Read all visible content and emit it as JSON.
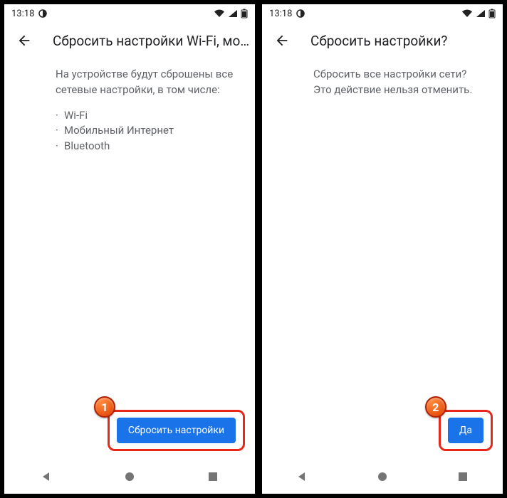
{
  "status": {
    "time": "13:18"
  },
  "screens": [
    {
      "title": "Сбросить настройки Wi-Fi, мо…",
      "body": "На устройстве будут сброшены все сетевые настройки, в том числе:",
      "items": [
        "Wi-Fi",
        "Мобильный Интернет",
        "Bluetooth"
      ],
      "button": "Сбросить настройки",
      "step": "1"
    },
    {
      "title": "Сбросить настройки?",
      "body": "Сбросить все настройки сети? Это действие нельзя отменить.",
      "items": [],
      "button": "Да",
      "step": "2"
    }
  ]
}
